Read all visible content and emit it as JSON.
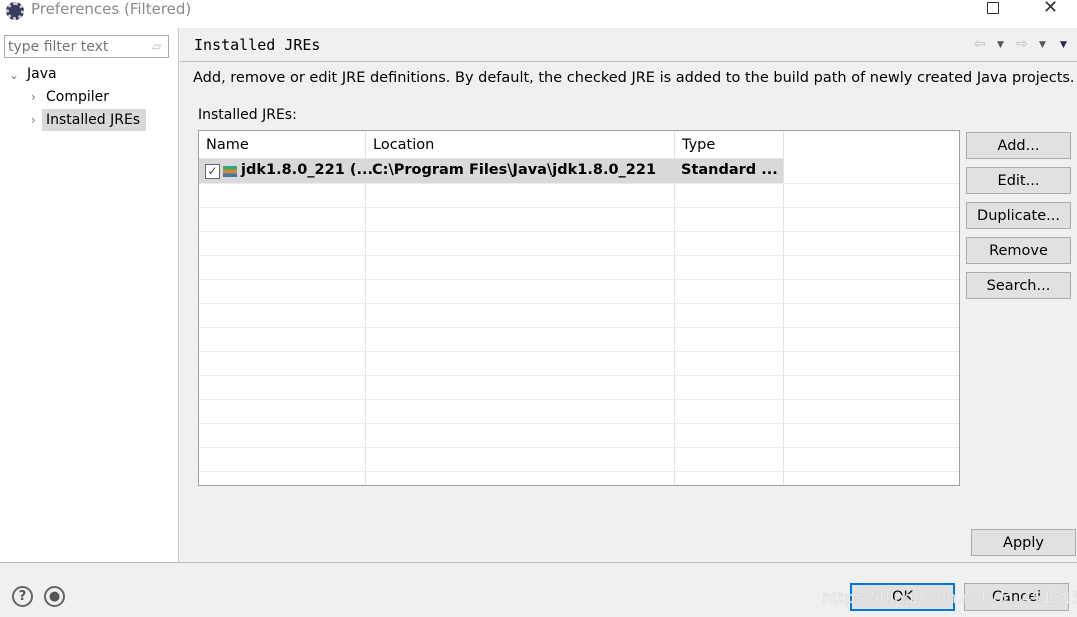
{
  "window": {
    "title": "Preferences (Filtered)"
  },
  "sidebar": {
    "filter_placeholder": "type filter text",
    "tree": [
      {
        "label": "Java",
        "expanded": true
      },
      {
        "label": "Compiler"
      },
      {
        "label": "Installed JREs",
        "selected": true
      }
    ]
  },
  "page": {
    "title": "Installed JREs",
    "description": "Add, remove or edit JRE definitions. By default, the checked JRE is added to the build path of newly created Java projects.",
    "table_label": "Installed JREs:",
    "columns": [
      "Name",
      "Location",
      "Type"
    ],
    "rows": [
      {
        "checked": true,
        "name": "jdk1.8.0_221 (...",
        "location": "C:\\Program Files\\Java\\jdk1.8.0_221",
        "type": "Standard ..."
      }
    ]
  },
  "buttons": {
    "add": "Add...",
    "edit": "Edit...",
    "duplicate": "Duplicate...",
    "remove": "Remove",
    "search": "Search...",
    "apply": "Apply",
    "ok": "OK",
    "cancel": "Cancel"
  },
  "footer": {
    "help_icon": "?"
  },
  "watermark": "https://blog.csdn.net/qq_45131584",
  "colors": {
    "ok_border": "#0078d7",
    "selection": "#d9d9d9"
  }
}
